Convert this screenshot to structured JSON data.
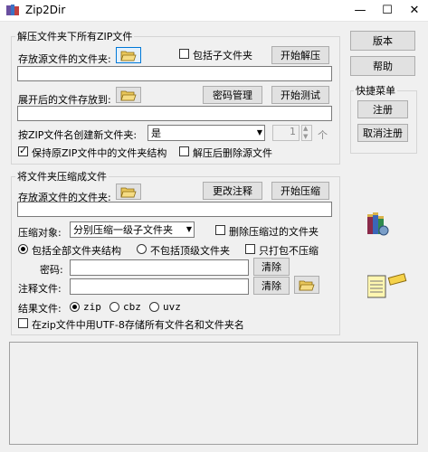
{
  "window": {
    "title": "Zip2Dir",
    "minimize": "—",
    "maximize": "☐",
    "close": "✕"
  },
  "extract": {
    "group_title": "解压文件夹下所有ZIP文件",
    "source_label": "存放源文件的文件夹:",
    "include_subfolders": "包括子文件夹",
    "include_subfolders_checked": false,
    "start_extract": "开始解压",
    "source_value": "",
    "dest_label": "展开后的文件存放到:",
    "password_mgmt": "密码管理",
    "start_test": "开始测试",
    "dest_value": "",
    "create_folder_label": "按ZIP文件名创建新文件夹:",
    "create_folder_value": "是",
    "spin_value": "1",
    "spin_unit": "个",
    "keep_structure": "保持原ZIP文件中的文件夹结构",
    "keep_structure_checked": true,
    "delete_after": "解压后删除源文件",
    "delete_after_checked": false
  },
  "compress": {
    "group_title": "将文件夹压缩成文件",
    "source_label": "存放源文件的文件夹:",
    "change_comment": "更改注释",
    "start_compress": "开始压缩",
    "source_value": "",
    "target_label": "压缩对象:",
    "target_value": "分别压缩一级子文件夹",
    "delete_compressed": "删除压缩过的文件夹",
    "delete_compressed_checked": false,
    "structure_all": "包括全部文件夹结构",
    "structure_all_selected": true,
    "structure_no_top": "不包括顶级文件夹",
    "pack_only": "只打包不压缩",
    "pack_only_checked": false,
    "password_label": "密码:",
    "password_value": "",
    "clear_label": "清除",
    "comment_label": "注释文件:",
    "comment_value": "",
    "clear2_label": "清除",
    "result_label": "结果文件:",
    "fmt_zip": "zip",
    "fmt_cbz": "cbz",
    "fmt_uvz": "uvz",
    "selected_format": "zip",
    "utf8": "在zip文件中用UTF-8存储所有文件名和文件夹名",
    "utf8_checked": false
  },
  "side": {
    "version": "版本",
    "help": "帮助",
    "quick_menu_title": "快捷菜单",
    "register": "注册",
    "unregister": "取消注册"
  },
  "log": {
    "text": ""
  },
  "icons": {
    "app": "zip2dir-app-icon",
    "folder": "open-folder-icon",
    "books": "books-icon",
    "notes": "notes-icon"
  }
}
